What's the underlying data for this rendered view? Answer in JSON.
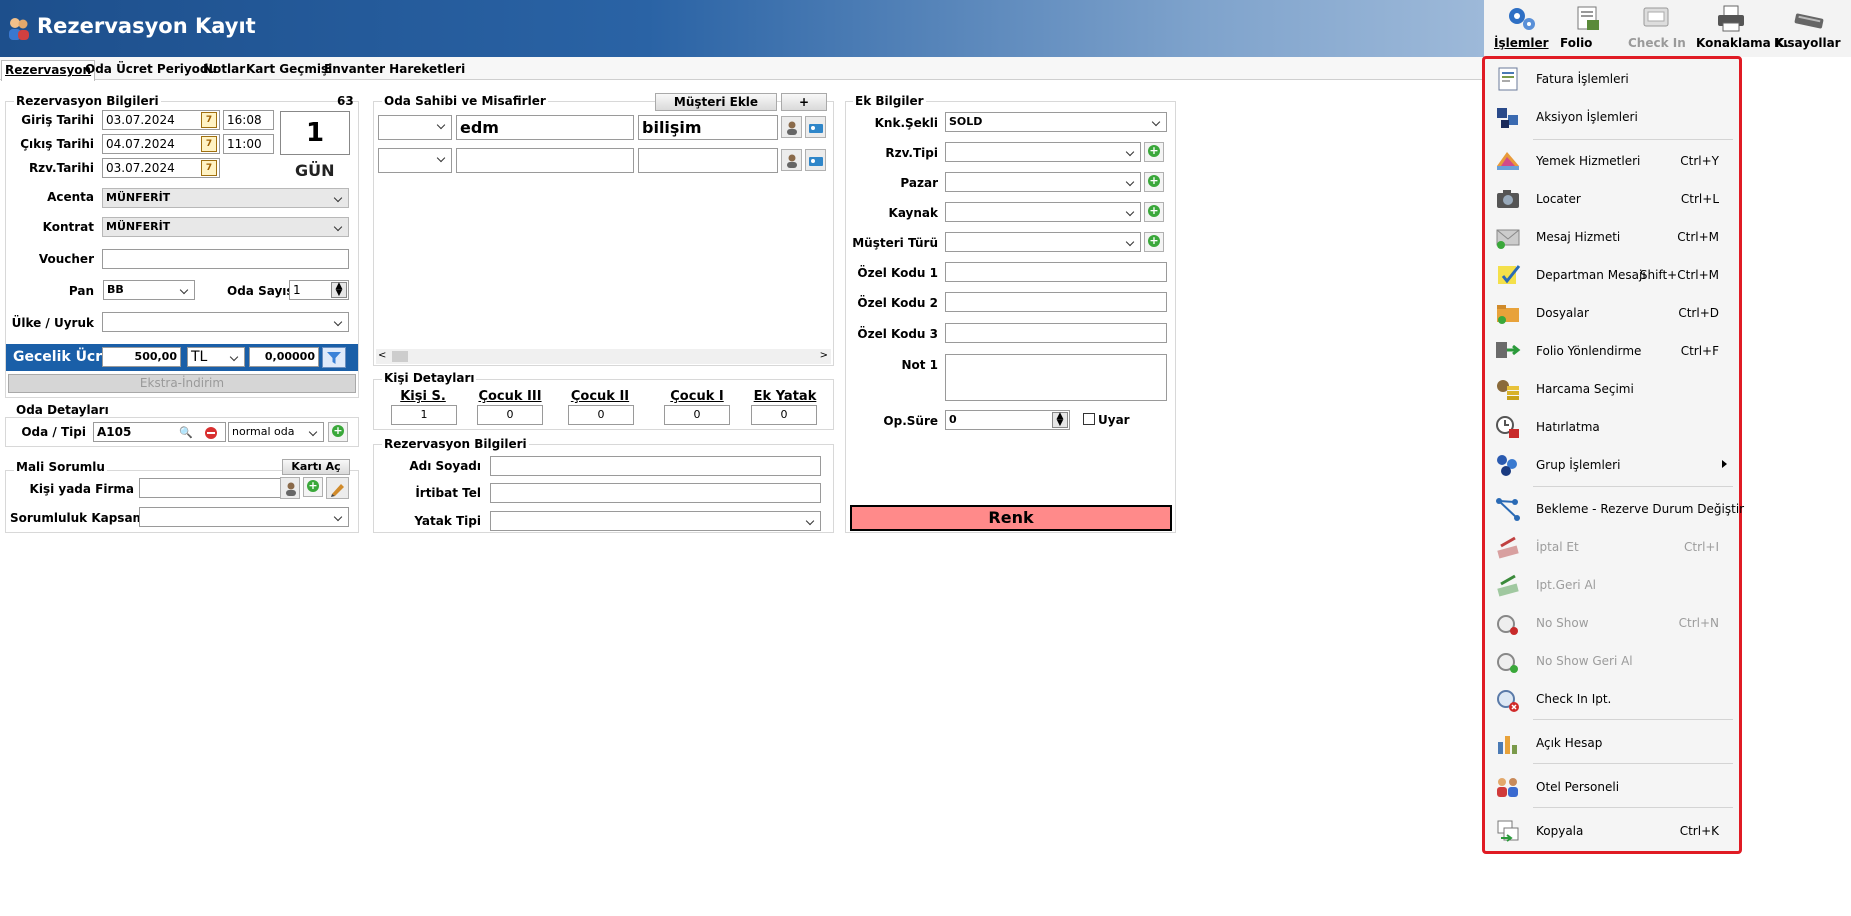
{
  "window": {
    "title": "Rezervasyon Kayıt"
  },
  "toolbar": {
    "islemler": "İşlemler",
    "folio": "Folio",
    "checkin": "Check In",
    "konaklama": "Konaklama K.",
    "kisayollar": "Kısayollar"
  },
  "tabs": [
    "Rezervasyon",
    "Oda Ücret Periyodu",
    "Notlar",
    "Kart Geçmişi",
    "Envanter Hareketleri"
  ],
  "rez": {
    "group_title": "Rezervasyon Bilgileri",
    "count": "63",
    "giris_label": "Giriş Tarihi",
    "giris_date": "03.07.2024",
    "giris_time": "16:08",
    "cikis_label": "Çıkış Tarihi",
    "cikis_date": "04.07.2024",
    "cikis_time": "11:00",
    "rzv_label": "Rzv.Tarihi",
    "rzv_date": "03.07.2024",
    "nights": "1",
    "nights_unit": "GÜN",
    "acenta_label": "Acenta",
    "acenta": "MÜNFERİT",
    "kontrat_label": "Kontrat",
    "kontrat": "MÜNFERİT",
    "voucher_label": "Voucher",
    "voucher": "",
    "pan_label": "Pan",
    "pan": "BB",
    "oda_sayisi_label": "Oda Sayısı",
    "oda_sayisi": "1",
    "ulke_label": "Ülke / Uyruk",
    "ulke": "",
    "gecelik_label": "Gecelik Ücret",
    "gecelik": "500,00",
    "currency": "TL",
    "rate": "0,00000",
    "ekstra": "Ekstra-İndirim"
  },
  "oda": {
    "group_title": "Oda Detayları",
    "label": "Oda / Tipi",
    "room": "A105",
    "type": "normal oda"
  },
  "mali": {
    "group_title": "Mali Sorumlu",
    "kart_ac": "Kartı Aç",
    "kisi_label": "Kişi yada Firma",
    "kisi": "",
    "kapsam_label": "Sorumluluk Kapsamı",
    "kapsam": ""
  },
  "guests": {
    "group_title": "Oda Sahibi ve Misafirler",
    "add_btn": "Müşteri Ekle",
    "plus_btn": "+",
    "rows": [
      {
        "title": "",
        "first": "edm",
        "last": "bilişim"
      },
      {
        "title": "",
        "first": "",
        "last": ""
      }
    ]
  },
  "kisi": {
    "group_title": "Kişi Detayları",
    "cols": [
      "Kişi S.",
      "Çocuk III",
      "Çocuk II",
      "Çocuk I",
      "Ek Yatak"
    ],
    "vals": [
      "1",
      "0",
      "0",
      "0",
      "0"
    ]
  },
  "rez2": {
    "group_title": "Rezervasyon Bilgileri",
    "adi_label": "Adı Soyadı",
    "adi": "",
    "irtibat_label": "İrtibat Tel",
    "irtibat": "",
    "yatak_label": "Yatak Tipi",
    "yatak": ""
  },
  "ek": {
    "group_title": "Ek Bilgiler",
    "knk_label": "Knk.Şekli",
    "knk": "SOLD",
    "rzv_tipi_label": "Rzv.Tipi",
    "pazar_label": "Pazar",
    "kaynak_label": "Kaynak",
    "musteri_turu_label": "Müşteri Türü",
    "ozel1_label": "Özel Kodu 1",
    "ozel2_label": "Özel Kodu 2",
    "ozel3_label": "Özel Kodu 3",
    "not1_label": "Not 1",
    "op_label": "Op.Süre",
    "op": "0",
    "uyar": "Uyar",
    "renk": "Renk"
  },
  "menu": {
    "items": [
      {
        "label": "Fatura İşlemleri",
        "shortcut": ""
      },
      {
        "label": "Aksiyon İşlemleri",
        "shortcut": ""
      },
      {
        "label": "Yemek Hizmetleri",
        "shortcut": "Ctrl+Y"
      },
      {
        "label": "Locater",
        "shortcut": "Ctrl+L"
      },
      {
        "label": "Mesaj Hizmeti",
        "shortcut": "Ctrl+M"
      },
      {
        "label": "Departman Mesajı",
        "shortcut": "Shift+Ctrl+M"
      },
      {
        "label": "Dosyalar",
        "shortcut": "Ctrl+D"
      },
      {
        "label": "Folio Yönlendirme",
        "shortcut": "Ctrl+F"
      },
      {
        "label": "Harcama Seçimi",
        "shortcut": ""
      },
      {
        "label": "Hatırlatma",
        "shortcut": ""
      },
      {
        "label": "Grup İşlemleri",
        "shortcut": ""
      },
      {
        "label": "Bekleme - Rezerve Durum Değiştir",
        "shortcut": ""
      },
      {
        "label": "İptal Et",
        "shortcut": "Ctrl+I"
      },
      {
        "label": "Ipt.Geri Al",
        "shortcut": ""
      },
      {
        "label": "No Show",
        "shortcut": "Ctrl+N"
      },
      {
        "label": "No Show Geri Al",
        "shortcut": ""
      },
      {
        "label": "Check In Ipt.",
        "shortcut": ""
      },
      {
        "label": "Açık Hesap",
        "shortcut": ""
      },
      {
        "label": "Otel Personeli",
        "shortcut": ""
      },
      {
        "label": "Kopyala",
        "shortcut": "Ctrl+K"
      }
    ]
  },
  "colors": {
    "accent": "#1a5fa8",
    "menu_border": "#e01b24",
    "renk": "#ff8a8a"
  }
}
